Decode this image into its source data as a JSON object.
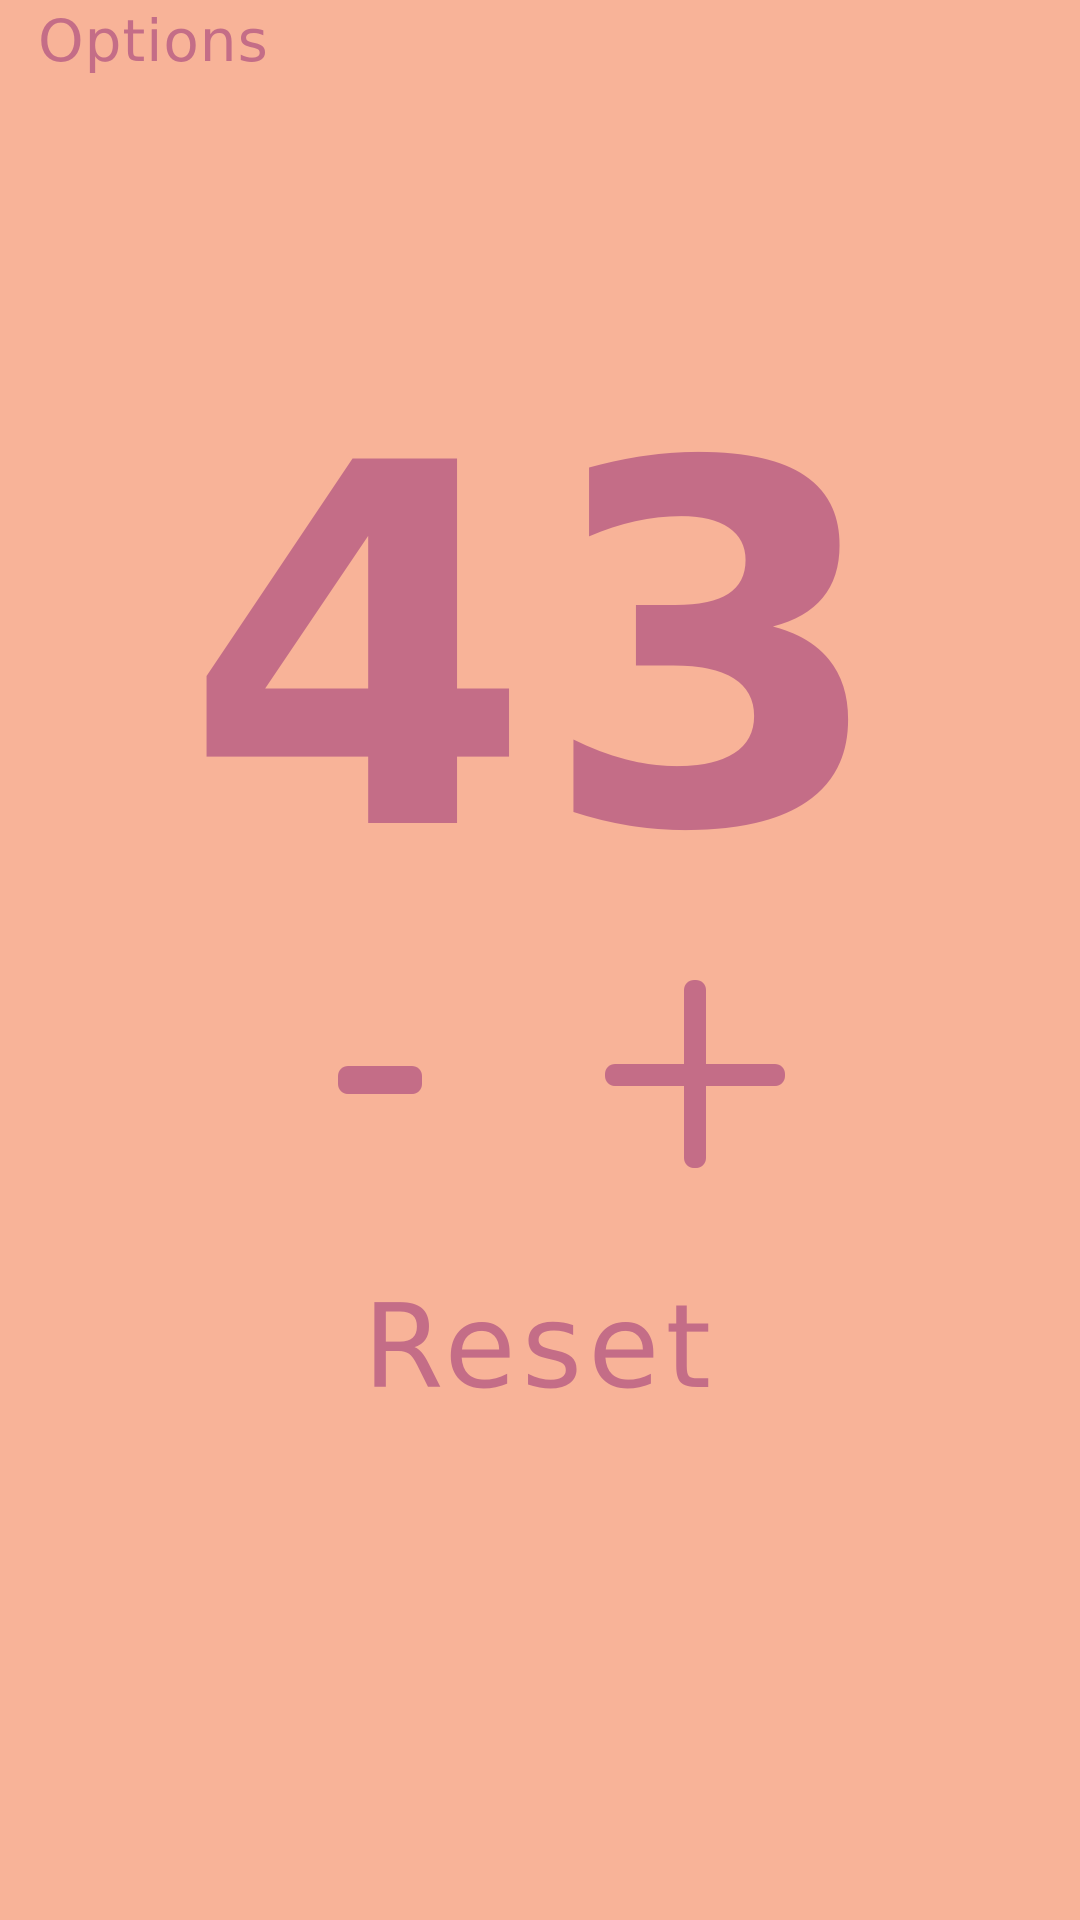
{
  "header": {
    "options_label": "Options"
  },
  "counter": {
    "value": "43"
  },
  "controls": {
    "decrement_icon": "minus-icon",
    "increment_icon": "plus-icon",
    "reset_label": "Reset"
  },
  "colors": {
    "background": "#F8B398",
    "accent": "#C46D87"
  }
}
